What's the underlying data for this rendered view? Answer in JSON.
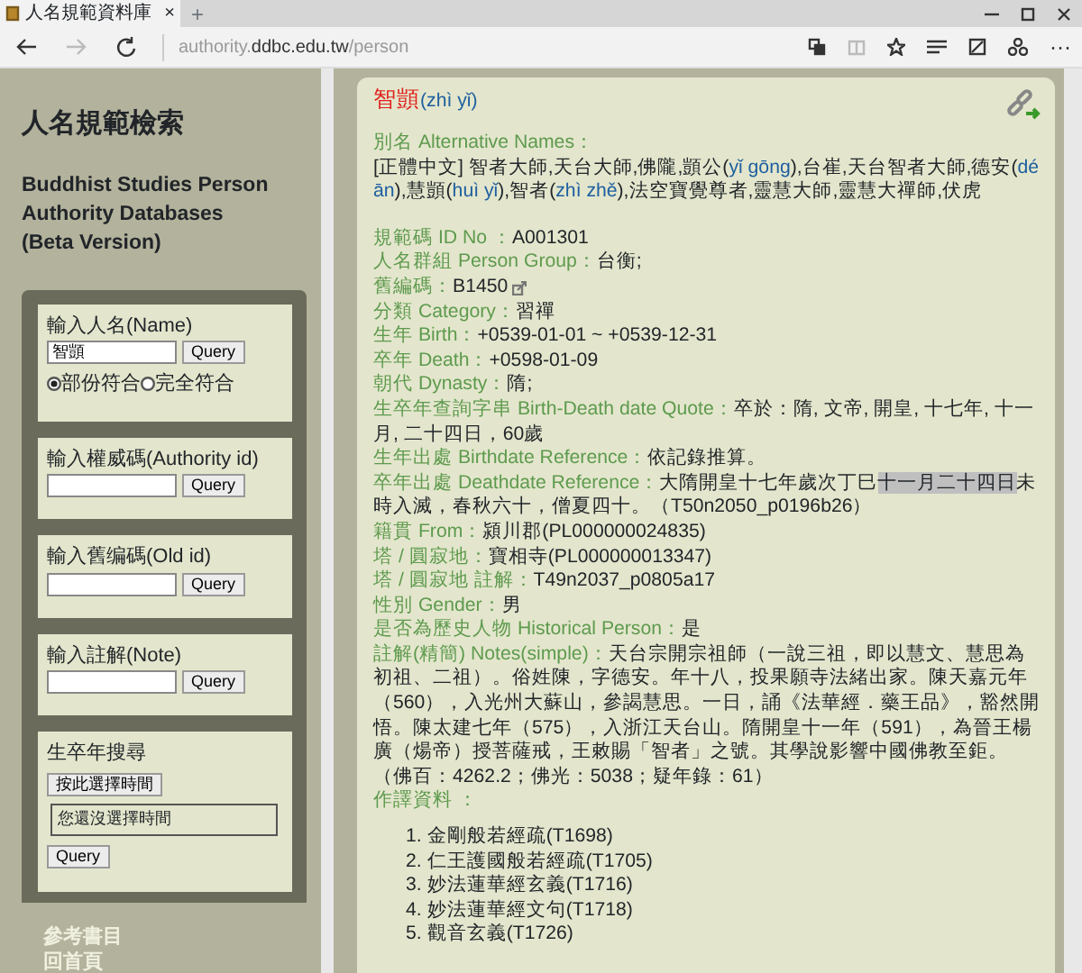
{
  "browser": {
    "tab_title": "人名規範資料庫",
    "tab_close": "×",
    "new_tab": "+",
    "url": [
      {
        "text": "authority.",
        "kind": "dim"
      },
      {
        "text": "ddbc.edu.tw",
        "kind": "host"
      },
      {
        "text": "/person",
        "kind": "dim"
      }
    ],
    "nav": [
      {
        "kind": "back",
        "disabled": false
      },
      {
        "kind": "forward",
        "disabled": true
      },
      {
        "kind": "refresh",
        "disabled": false
      }
    ],
    "more": "···"
  },
  "sidebar": {
    "title": "人名規範檢索",
    "subtitle_lines": [
      "Buddhist Studies Person",
      "Authority Databases",
      "(Beta Version)"
    ],
    "searches": [
      {
        "kind": "text",
        "label": "輸入人名(Name)",
        "value": "智顗",
        "button": "Query",
        "options": [
          {
            "label": "部份符合",
            "selected": true
          },
          {
            "label": "完全符合",
            "selected": false
          }
        ]
      },
      {
        "kind": "text",
        "label": "輸入權威碼(Authority id)",
        "button": "Query"
      },
      {
        "kind": "text",
        "label": "輸入舊编碼(Old id)",
        "button": "Query"
      },
      {
        "kind": "text",
        "label": "輸入註解(Note)",
        "button": "Query"
      },
      {
        "kind": "date",
        "label": "生卒年搜尋",
        "pick_button": "按此選擇時間",
        "display": "您還沒選擇時間",
        "button": "Query"
      }
    ],
    "links": [
      "參考書目",
      "回首頁"
    ]
  },
  "record": {
    "name": "智顗",
    "pinyin": "(zhì yǐ)",
    "alt_heading": "別名 Alternative Names：",
    "alt_names": [
      {
        "text": "[正體中文] 智者大師,天台大師,佛隴,顗公(",
        "kind": "plain"
      },
      {
        "text": "yǐ gōng",
        "kind": "pinyin"
      },
      {
        "text": "),台崔,天台智者大師,德安(",
        "kind": "plain"
      },
      {
        "text": "dé ān",
        "kind": "pinyin"
      },
      {
        "text": "),慧顗(",
        "kind": "plain"
      },
      {
        "text": "huì yǐ",
        "kind": "pinyin"
      },
      {
        "text": "),智者(",
        "kind": "plain"
      },
      {
        "text": "zhì zhě",
        "kind": "pinyin"
      },
      {
        "text": "),法空寶覺尊者,靈慧大師,靈慧大禪師,伏虎",
        "kind": "plain"
      }
    ],
    "fields": [
      {
        "label": "規範碼 ID No ：",
        "value": "A001301"
      },
      {
        "label": "人名群組 Person Group：",
        "value": "台衡;"
      },
      {
        "label": "舊編碼：",
        "value": "B1450",
        "external_link": true
      },
      {
        "label": "分類 Category：",
        "value": "習禪"
      },
      {
        "label": "生年 Birth：",
        "value": "+0539-01-01 ~ +0539-12-31"
      },
      {
        "label": "卒年 Death：",
        "value": "+0598-01-09"
      },
      {
        "label": "朝代 Dynasty：",
        "value": "隋;"
      },
      {
        "label": "生卒年查詢字串 Birth-Death date Quote：",
        "value": "卒於：隋, 文帝, 開皇, 十七年, 十一月, 二十四日，60歲"
      },
      {
        "label": "生年出處 Birthdate Reference：",
        "value": "依記錄推算。"
      },
      {
        "label": "卒年出處 Deathdate Reference：",
        "segments": [
          {
            "text": "大隋開皇十七年歲次丁巳",
            "kind": "plain"
          },
          {
            "text": "十一月二十四日",
            "kind": "highlight"
          },
          {
            "text": "未時入滅，春秋六十，僧夏四十。（T50n2050_p0196b26）",
            "kind": "plain"
          }
        ]
      },
      {
        "label": "籍貫 From：",
        "value": "潁川郡(PL000000024835)"
      },
      {
        "label": "塔 / 圓寂地：",
        "value": "寶相寺(PL000000013347)"
      },
      {
        "label": "塔 / 圓寂地 註解：",
        "value": "T49n2037_p0805a17"
      },
      {
        "label": "性別 Gender：",
        "value": "男"
      },
      {
        "label": "是否為歷史人物 Historical Person：",
        "value": "是"
      },
      {
        "label": "註解(精簡) Notes(simple)：",
        "value": "天台宗開宗祖師（一說三祖，即以慧文、慧思為初祖、二祖）。俗姓陳，字德安。年十八，投果願寺法緒出家。陳天嘉元年（560），入光州大蘇山，參謁慧思。一日，誦《法華經．藥王品》，豁然開悟。陳太建七年（575），入浙江天台山。隋開皇十一年（591），為晉王楊廣（煬帝）授菩薩戒，王敕賜「智者」之號。其學說影響中國佛教至鉅。（佛百：4262.2；佛光：5038；疑年錄：61）"
      }
    ],
    "works_heading": "作譯資料 ：",
    "works": [
      {
        "number": "1.",
        "title": "金剛般若經疏(T1698)"
      },
      {
        "number": "2.",
        "title": "仁王護國般若經疏(T1705)"
      },
      {
        "number": "3.",
        "title": "妙法蓮華經玄義(T1716)"
      },
      {
        "number": "4.",
        "title": "妙法蓮華經文句(T1718)"
      },
      {
        "number": "5.",
        "title": "觀音玄義(T1726)"
      }
    ]
  }
}
